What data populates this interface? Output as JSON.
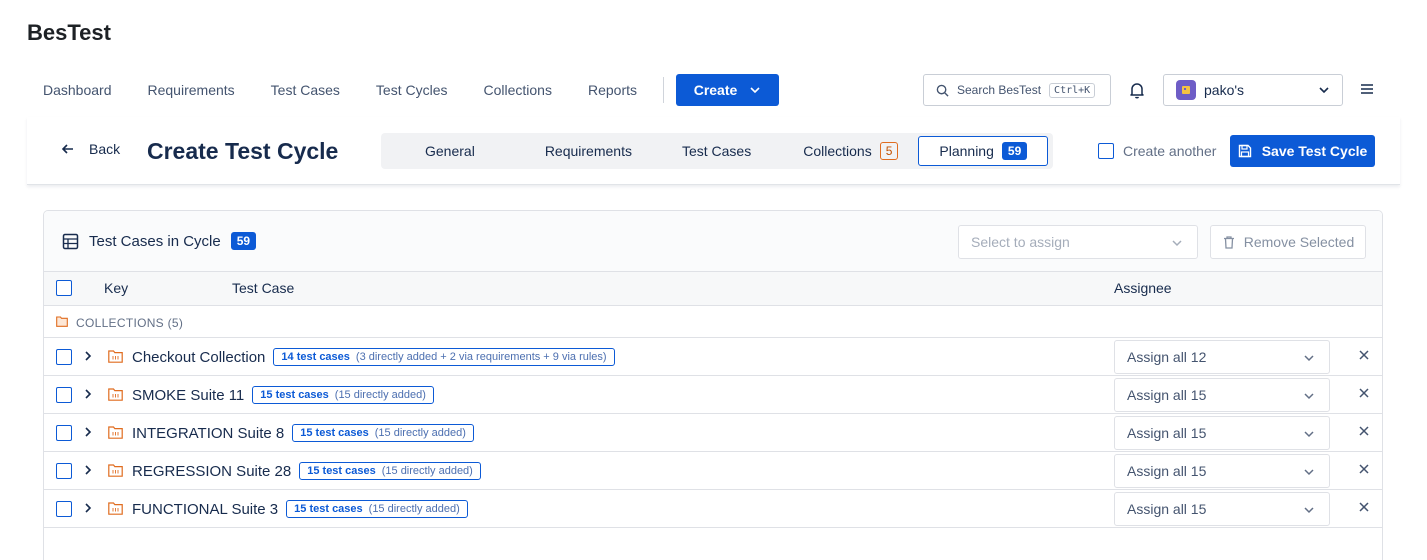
{
  "app": {
    "title": "BesTest"
  },
  "nav": {
    "items": [
      "Dashboard",
      "Requirements",
      "Test Cases",
      "Test Cycles",
      "Collections",
      "Reports"
    ],
    "create_label": "Create",
    "search_placeholder": "Search BesTest",
    "search_shortcut": "Ctrl+K",
    "account_name": "pako's"
  },
  "header": {
    "back_label": "Back",
    "title": "Create Test Cycle",
    "tabs": [
      {
        "label": "General",
        "badge": ""
      },
      {
        "label": "Requirements",
        "badge": ""
      },
      {
        "label": "Test Cases",
        "badge": ""
      },
      {
        "label": "Collections",
        "badge": "5"
      },
      {
        "label": "Planning",
        "badge": "59"
      }
    ],
    "active_tab": "Planning",
    "create_another_label": "Create another",
    "save_label": "Save Test Cycle"
  },
  "panel": {
    "title": "Test Cases in Cycle",
    "count": "59",
    "assign_placeholder": "Select to assign",
    "remove_label": "Remove Selected",
    "columns": {
      "key": "Key",
      "test_case": "Test Case",
      "assignee": "Assignee"
    },
    "section_label": "COLLECTIONS (5)",
    "rows": [
      {
        "name": "Checkout Collection",
        "count": "14 test cases",
        "detail": "(3 directly added + 2 via requirements + 9 via rules)",
        "assign": "Assign all 12"
      },
      {
        "name": "SMOKE Suite 11",
        "count": "15 test cases",
        "detail": "(15 directly added)",
        "assign": "Assign all 15"
      },
      {
        "name": "INTEGRATION Suite 8",
        "count": "15 test cases",
        "detail": "(15 directly added)",
        "assign": "Assign all 15"
      },
      {
        "name": "REGRESSION Suite 28",
        "count": "15 test cases",
        "detail": "(15 directly added)",
        "assign": "Assign all 15"
      },
      {
        "name": "FUNCTIONAL Suite 3",
        "count": "15 test cases",
        "detail": "(15 directly added)",
        "assign": "Assign all 15"
      }
    ]
  },
  "colors": {
    "primary": "#0c5ad6",
    "collection_orange": "#e06c1f",
    "border": "#dfe1e6"
  },
  "icons": [
    "search-icon",
    "bell-icon",
    "hamburger-menu-icon",
    "chevron-down-icon",
    "arrow-left-icon",
    "save-icon",
    "table-grid-icon",
    "trash-icon",
    "folder-icon",
    "chevron-right-icon",
    "close-icon"
  ]
}
